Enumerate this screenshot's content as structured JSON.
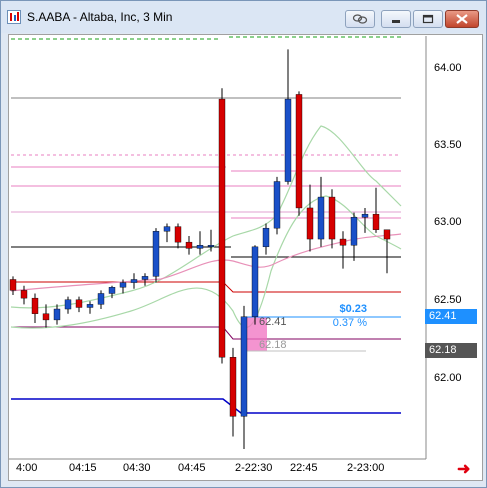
{
  "window": {
    "title": "S.AABA - Altaba, Inc, 3 Min"
  },
  "toolbar": {
    "link_icon": "link-icon",
    "minimize_icon": "minimize-icon",
    "restore_icon": "restore-icon",
    "close_icon": "close-icon"
  },
  "price_axis": {
    "ticks": [
      "64.00",
      "63.50",
      "63.00",
      "62.50",
      "62.00"
    ]
  },
  "markers": {
    "bid_price": "62.41",
    "bid_color": "#1e90ff",
    "ask_price": "62.18",
    "ask_color": "#555555"
  },
  "position": {
    "pnl": "$0.23",
    "pnl_pct": "0.37 %",
    "entry_label": "62.41",
    "stop_label": "62.18"
  },
  "time_axis": {
    "labels": [
      "4:00",
      "04:15",
      "04:30",
      "04:45",
      "2-22:30",
      "22:45",
      "2-23:00"
    ]
  },
  "nav": {
    "scroll_right_icon": "arrow-right-icon"
  },
  "chart_data": {
    "type": "candlestick",
    "symbol": "S.AABA",
    "interval": "3 Min",
    "ylim": [
      61.55,
      64.3
    ],
    "candles": [
      {
        "o": 62.64,
        "h": 62.66,
        "l": 62.54,
        "c": 62.57
      },
      {
        "o": 62.57,
        "h": 62.6,
        "l": 62.48,
        "c": 62.52
      },
      {
        "o": 62.52,
        "h": 62.55,
        "l": 62.36,
        "c": 62.42
      },
      {
        "o": 62.42,
        "h": 62.48,
        "l": 62.33,
        "c": 62.38
      },
      {
        "o": 62.38,
        "h": 62.48,
        "l": 62.35,
        "c": 62.45
      },
      {
        "o": 62.45,
        "h": 62.53,
        "l": 62.42,
        "c": 62.51
      },
      {
        "o": 62.51,
        "h": 62.53,
        "l": 62.43,
        "c": 62.46
      },
      {
        "o": 62.46,
        "h": 62.5,
        "l": 62.42,
        "c": 62.48
      },
      {
        "o": 62.48,
        "h": 62.57,
        "l": 62.45,
        "c": 62.55
      },
      {
        "o": 62.55,
        "h": 62.6,
        "l": 62.52,
        "c": 62.59
      },
      {
        "o": 62.59,
        "h": 62.64,
        "l": 62.55,
        "c": 62.62
      },
      {
        "o": 62.62,
        "h": 62.68,
        "l": 62.58,
        "c": 62.64
      },
      {
        "o": 62.64,
        "h": 62.68,
        "l": 62.6,
        "c": 62.66
      },
      {
        "o": 62.66,
        "h": 62.97,
        "l": 62.62,
        "c": 62.95
      },
      {
        "o": 62.95,
        "h": 63.0,
        "l": 62.88,
        "c": 62.98
      },
      {
        "o": 62.98,
        "h": 63.0,
        "l": 62.84,
        "c": 62.88
      },
      {
        "o": 62.88,
        "h": 62.92,
        "l": 62.8,
        "c": 62.84
      },
      {
        "o": 62.84,
        "h": 62.95,
        "l": 62.8,
        "c": 62.86
      },
      {
        "o": 62.86,
        "h": 62.96,
        "l": 62.82,
        "c": 62.86
      },
      {
        "o": 63.8,
        "h": 63.87,
        "l": 62.1,
        "c": 62.14
      },
      {
        "o": 62.14,
        "h": 62.2,
        "l": 61.63,
        "c": 61.76
      },
      {
        "o": 61.76,
        "h": 62.47,
        "l": 61.55,
        "c": 62.4
      },
      {
        "o": 62.4,
        "h": 62.86,
        "l": 62.35,
        "c": 62.85
      },
      {
        "o": 62.85,
        "h": 63.0,
        "l": 62.8,
        "c": 62.97
      },
      {
        "o": 62.97,
        "h": 63.3,
        "l": 62.93,
        "c": 63.27
      },
      {
        "o": 63.27,
        "h": 64.12,
        "l": 63.25,
        "c": 63.8
      },
      {
        "o": 63.83,
        "h": 63.85,
        "l": 63.05,
        "c": 63.1
      },
      {
        "o": 63.1,
        "h": 63.25,
        "l": 62.82,
        "c": 62.9
      },
      {
        "o": 62.9,
        "h": 63.3,
        "l": 62.85,
        "c": 63.17
      },
      {
        "o": 63.17,
        "h": 63.22,
        "l": 62.84,
        "c": 62.9
      },
      {
        "o": 62.9,
        "h": 62.95,
        "l": 62.71,
        "c": 62.86
      },
      {
        "o": 62.86,
        "h": 63.07,
        "l": 62.76,
        "c": 63.04
      },
      {
        "o": 63.04,
        "h": 63.1,
        "l": 62.94,
        "c": 63.06
      },
      {
        "o": 63.06,
        "h": 63.23,
        "l": 62.94,
        "c": 62.96
      },
      {
        "o": 62.96,
        "h": 62.96,
        "l": 62.68,
        "c": 62.9
      }
    ]
  }
}
